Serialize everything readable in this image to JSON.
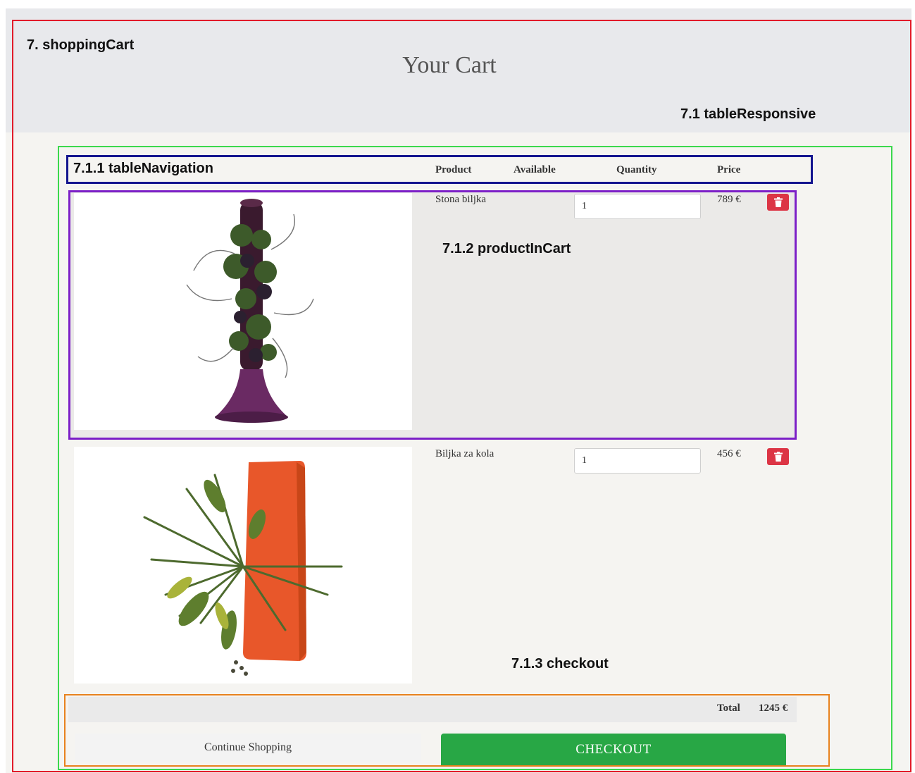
{
  "annotations": {
    "shopping_cart": "7. shoppingCart",
    "table_responsive": "7.1 tableResponsive",
    "table_navigation": "7.1.1 tableNavigation",
    "product_in_cart": "7.1.2 productInCart",
    "checkout": "7.1.3 checkout"
  },
  "cart": {
    "title": "Your Cart",
    "columns": [
      "Product",
      "Available",
      "Quantity",
      "Price"
    ],
    "items": [
      {
        "name": "Stona biljka",
        "quantity": "1",
        "price": "789 €",
        "image_icon": "tall-vase-plant-image",
        "delete_icon": "trash-icon"
      },
      {
        "name": "Biljka za kola",
        "quantity": "1",
        "price": "456 €",
        "image_icon": "wall-planter-image",
        "delete_icon": "trash-icon"
      }
    ],
    "total_label": "Total",
    "total_value": "1245 €",
    "continue_label": "Continue Shopping",
    "checkout_label": "CHECKOUT"
  },
  "colors": {
    "header_band": "#e8e9ec",
    "page_bg": "#f5f4f1",
    "delete_red": "#dc3545",
    "checkout_green": "#28a745",
    "box_red": "#e21b2a",
    "box_green": "#3bd84d",
    "box_blue": "#14158f",
    "box_purple": "#7c1fc7",
    "box_orange": "#e8821e"
  }
}
